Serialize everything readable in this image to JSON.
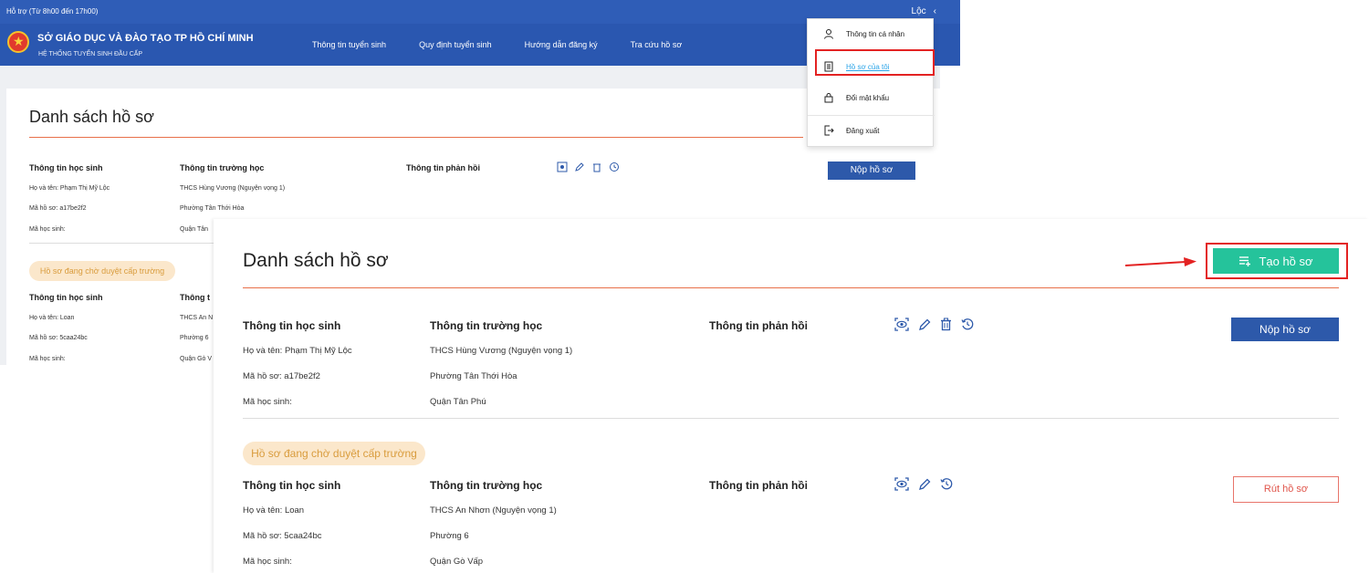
{
  "top_bar": {
    "support": "Hỗ trợ (Từ 8h00 đến 17h00)",
    "user_name": "Lộc",
    "user_caret": "‹"
  },
  "header": {
    "org_name": "SỞ GIÁO DỤC VÀ ĐÀO TẠO TP HỒ CHÍ MINH",
    "system_name": "HỆ THỐNG TUYỂN SINH ĐẦU CẤP",
    "nav": [
      "Thông tin tuyển sinh",
      "Quy định tuyển sinh",
      "Hướng dẫn đăng ký",
      "Tra cứu hồ sơ"
    ]
  },
  "user_menu": {
    "items": [
      {
        "label": "Thông tin cá nhân",
        "icon": "user-icon"
      },
      {
        "label": "Hồ sơ của tôi",
        "icon": "document-icon",
        "active": true
      },
      {
        "label": "Đổi mật khẩu",
        "icon": "lock-icon"
      },
      {
        "label": "Đăng xuất",
        "icon": "logout-icon"
      }
    ]
  },
  "background_page": {
    "title": "Danh sách hồ sơ",
    "col_student": "Thông tin học sinh",
    "col_school": "Thông tin trường học",
    "col_feedback": "Thông tin phản hồi",
    "submit_label": "Nộp hồ sơ",
    "record1": {
      "name": "Họ và tên: Phạm Thị Mỹ Lộc",
      "code": "Mã hồ sơ: a17be2f2",
      "student_id": "Mã học sinh:",
      "school": "THCS Hùng Vương (Nguyện vọng 1)",
      "ward": "Phường Tân Thới Hòa",
      "district": "Quận Tân"
    },
    "status_badge": "Hồ sơ đang chờ duyệt cấp trường",
    "record2": {
      "name": "Họ và tên: Loan",
      "code": "Mã hồ sơ: 5caa24bc",
      "student_id": "Mã học sinh:",
      "col_school_partial": "Thông t",
      "school": "THCS An N",
      "ward": "Phường 6",
      "district": "Quận Gò V"
    }
  },
  "panel": {
    "title": "Danh sách hồ sơ",
    "create_label": "Tạo hồ sơ",
    "col_student": "Thông tin học sinh",
    "col_school": "Thông tin trường học",
    "col_feedback": "Thông tin phản hồi",
    "record1": {
      "name": "Họ và tên: Phạm Thị Mỹ Lộc",
      "code": "Mã hồ sơ: a17be2f2",
      "student_id": "Mã học sinh:",
      "school": "THCS Hùng Vương (Nguyện vọng 1)",
      "ward": "Phường Tân Thới Hòa",
      "district": "Quận Tân Phú",
      "action_label": "Nộp hồ sơ"
    },
    "status_badge": "Hồ sơ đang chờ duyệt cấp trường",
    "record2": {
      "name": "Họ và tên: Loan",
      "code": "Mã hồ sơ: 5caa24bc",
      "student_id": "Mã học sinh:",
      "school": "THCS An Nhơn (Nguyện vọng 1)",
      "ward": "Phường 6",
      "district": "Quận Gò Vấp",
      "action_label": "Rút hồ sơ"
    }
  },
  "colors": {
    "header_blue": "#2a57b0",
    "accent_orange": "#e86f49",
    "create_green": "#25c39b",
    "highlight_red": "#e32222"
  }
}
